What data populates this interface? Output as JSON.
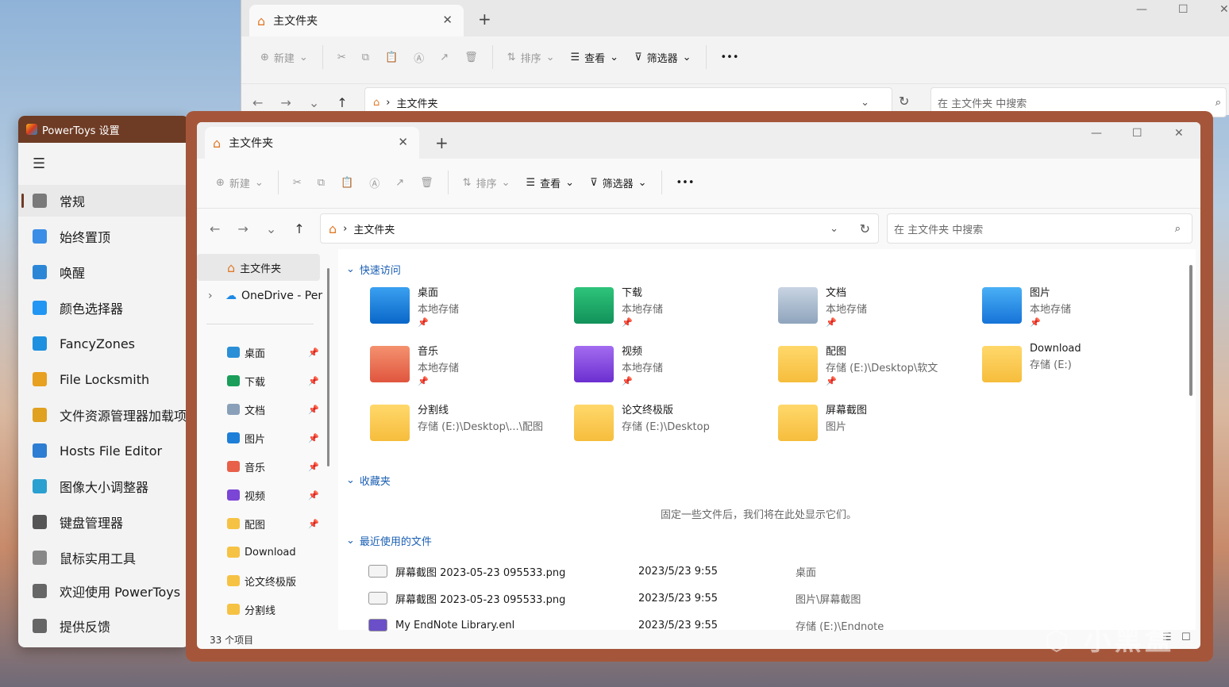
{
  "back_window": {
    "tab_title": "主文件夹",
    "address": "主文件夹",
    "search_placeholder": "在 主文件夹 中搜索",
    "cmd": {
      "new": "新建",
      "sort": "排序",
      "view": "查看",
      "filter": "筛选器",
      "more": "•••"
    }
  },
  "powertoys": {
    "title": "PowerToys 设置",
    "items": [
      {
        "label": "常规",
        "icon": "gear-icon"
      },
      {
        "label": "始终置顶",
        "icon": "pin-window-icon"
      },
      {
        "label": "唤醒",
        "icon": "coffee-icon"
      },
      {
        "label": "颜色选择器",
        "icon": "color-picker-icon"
      },
      {
        "label": "FancyZones",
        "icon": "fancyzones-icon"
      },
      {
        "label": "File Locksmith",
        "icon": "lock-icon"
      },
      {
        "label": "文件资源管理器加载项",
        "icon": "folder-addon-icon"
      },
      {
        "label": "Hosts File Editor",
        "icon": "hosts-icon"
      },
      {
        "label": "图像大小调整器",
        "icon": "image-resize-icon"
      },
      {
        "label": "键盘管理器",
        "icon": "keyboard-icon"
      },
      {
        "label": "鼠标实用工具",
        "icon": "mouse-icon"
      },
      {
        "label": "欢迎使用 PowerToys",
        "icon": "welcome-icon"
      },
      {
        "label": "提供反馈",
        "icon": "feedback-icon"
      }
    ]
  },
  "front_window": {
    "tab_title": "主文件夹",
    "address": "主文件夹",
    "search_placeholder": "在 主文件夹 中搜索",
    "cmd": {
      "new": "新建",
      "sort": "排序",
      "view": "查看",
      "filter": "筛选器",
      "more": "•••"
    },
    "sidebar": {
      "home": "主文件夹",
      "onedrive": "OneDrive - Per",
      "items": [
        "桌面",
        "下载",
        "文档",
        "图片",
        "音乐",
        "视频",
        "配图",
        "Download",
        "论文终极版",
        "分割线"
      ]
    },
    "quick_access_title": "快速访问",
    "tiles": [
      {
        "name": "桌面",
        "sub": "本地存储",
        "pin": "📌"
      },
      {
        "name": "下载",
        "sub": "本地存储",
        "pin": "📌"
      },
      {
        "name": "文档",
        "sub": "本地存储",
        "pin": "📌"
      },
      {
        "name": "图片",
        "sub": "本地存储",
        "pin": "📌"
      },
      {
        "name": "音乐",
        "sub": "本地存储",
        "pin": "📌"
      },
      {
        "name": "视频",
        "sub": "本地存储",
        "pin": "📌"
      },
      {
        "name": "配图",
        "sub": "存储 (E:)\\Desktop\\软文",
        "pin": "📌"
      },
      {
        "name": "Download",
        "sub": "存储 (E:)",
        "pin": ""
      },
      {
        "name": "分割线",
        "sub": "存储 (E:)\\Desktop\\...\\配图",
        "pin": ""
      },
      {
        "name": "论文终极版",
        "sub": "存储 (E:)\\Desktop",
        "pin": ""
      },
      {
        "name": "屏幕截图",
        "sub": "图片",
        "pin": ""
      }
    ],
    "favorites_title": "收藏夹",
    "favorites_empty": "固定一些文件后，我们将在此处显示它们。",
    "recent_title": "最近使用的文件",
    "recent": [
      {
        "name": "屏幕截图 2023-05-23 095533.png",
        "date": "2023/5/23 9:55",
        "loc": "桌面"
      },
      {
        "name": "屏幕截图 2023-05-23 095533.png",
        "date": "2023/5/23 9:55",
        "loc": "图片\\屏幕截图"
      },
      {
        "name": "My EndNote Library.enl",
        "date": "2023/5/23 9:55",
        "loc": "存储 (E:)\\Endnote"
      }
    ],
    "status": "33 个项目"
  },
  "watermark": "小黑盒",
  "colors": {
    "accent": "#6e3b24",
    "frame": "#a5563a",
    "link": "#1a5fb4"
  }
}
